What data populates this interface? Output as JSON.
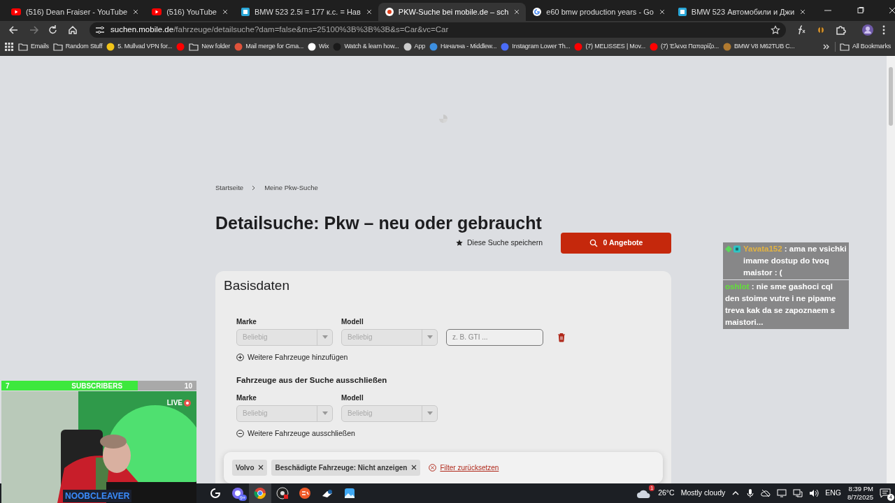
{
  "browser": {
    "tabs": [
      {
        "title": "(516) Dean Fraiser - YouTube",
        "kind": "video",
        "selected": false
      },
      {
        "title": "(516) YouTube",
        "kind": "video",
        "selected": false
      },
      {
        "title": "BMW 523 2.5i = 177 к.с. = Нав",
        "kind": "site",
        "selected": false
      },
      {
        "title": "PKW-Suche bei mobile.de – sch",
        "kind": "target",
        "selected": true
      },
      {
        "title": "e60 bmw production years - Go",
        "kind": "search",
        "selected": false
      },
      {
        "title": "BMW 523 Автомобили и Джи",
        "kind": "site",
        "selected": false
      }
    ],
    "url_host": "suchen.mobile.de",
    "url_path": "/fahrzeuge/detailsuche?dam=false&ms=25100%3B%3B%3B&s=Car&vc=Car",
    "bookmarks": [
      {
        "kind": "folder",
        "label": "Emails"
      },
      {
        "kind": "folder",
        "label": "Random Stuff"
      },
      {
        "kind": "page",
        "label": "5. Mullvad VPN for...",
        "color": "#f2c418"
      },
      {
        "kind": "page",
        "color": "#ff0000"
      },
      {
        "kind": "folder",
        "label": "New folder"
      },
      {
        "kind": "page",
        "label": "Mail merge for Gma...",
        "color": "#e0533b"
      },
      {
        "kind": "page",
        "label": "Wix",
        "color": "#ffffff"
      },
      {
        "kind": "page",
        "label": "Watch & learn how...",
        "color": "#1a1a1a"
      },
      {
        "kind": "page",
        "label": "App",
        "color": "#cccccc"
      },
      {
        "kind": "page",
        "label": "Начална - Middlew...",
        "color": "#3d8fe0"
      },
      {
        "kind": "page",
        "label": "Instagram Lower Th...",
        "color": "#4a6cf7"
      },
      {
        "kind": "page",
        "label": "(7) MELISSES | Mov...",
        "color": "#ff0000"
      },
      {
        "kind": "page",
        "label": "(7) Έλενα Παπαρίζο...",
        "color": "#ff0000"
      },
      {
        "kind": "page",
        "label": "BMW V8 M62TUB C...",
        "color": "#b07a30"
      }
    ],
    "all_bookmarks": "All Bookmarks"
  },
  "page": {
    "breadcrumb": [
      "Startseite",
      "Meine Pkw-Suche"
    ],
    "title": "Detailsuche: Pkw – neu oder gebraucht",
    "save_search": "Diese Suche speichern",
    "results_button": "0 Angebote",
    "section_title": "Basisdaten",
    "include": {
      "make_label": "Marke",
      "make_value": "Beliebig",
      "model_label": "Modell",
      "model_value": "Beliebig",
      "disabled": true,
      "variant_placeholder": "z. B. GTI ...",
      "link": "Weitere Fahrzeuge hinzufügen"
    },
    "exclude": {
      "heading": "Fahrzeuge aus der Suche ausschließen",
      "make_label": "Marke",
      "make_value": "Beliebig",
      "model_label": "Modell",
      "model_value": "Beliebig",
      "disabled": true,
      "link": "Weitere Fahrzeuge ausschließen"
    },
    "filters": [
      {
        "label": "Volvo"
      },
      {
        "label": "Beschädigte Fahrzeuge: Nicht anzeigen"
      }
    ],
    "reset_link": "Filter zurücksetzen"
  },
  "stream": {
    "subscribers": {
      "current": "7",
      "label": "SUBSCRIBERS",
      "goal": "10",
      "level": 0.7
    },
    "live": "LIVE",
    "streamer": "NOOBCLEAVER",
    "chat": [
      {
        "user": "Yavata152",
        "color": "#e3b341",
        "text": ": ama ne vsichki imame dostup do tvoq maistor : (",
        "badges": true
      },
      {
        "user": "oshlot",
        "color": "#62e03a",
        "text": ": nie sme gashoci cql den stoime vutre i ne pipame treva kak da se zapoznaem s maistori...",
        "badges": false
      }
    ]
  },
  "taskbar": {
    "apps": [
      {
        "kind": "launcher",
        "selected": false
      },
      {
        "kind": "chat",
        "badge": "9+",
        "selected": false
      },
      {
        "kind": "browser",
        "selected": true
      },
      {
        "kind": "recorder",
        "selected": false
      },
      {
        "kind": "games",
        "selected": false
      },
      {
        "kind": "steam",
        "selected": false
      },
      {
        "kind": "photos",
        "selected": false
      }
    ],
    "weather_badge": "1",
    "temperature": "26°C",
    "weather": "Mostly cloudy",
    "language": "ENG",
    "time": "8:39 PM",
    "date": "8/7/2025",
    "notifications": "4"
  }
}
